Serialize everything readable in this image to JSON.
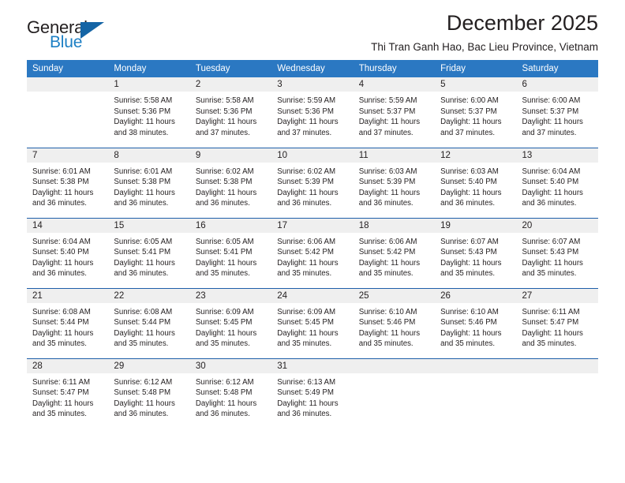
{
  "brand": {
    "name_part1": "General",
    "name_part2": "Blue",
    "logo_icon": "blue-triangle-icon",
    "color_primary": "#1464a5",
    "color_secondary": "#1c7fc4"
  },
  "header": {
    "title": "December 2025",
    "subtitle": "Thi Tran Ganh Hao, Bac Lieu Province, Vietnam"
  },
  "calendar": {
    "header_bg": "#2b78c2",
    "header_text_color": "#ffffff",
    "row_divider_color": "#1f5fa9",
    "daynum_band_color": "#efefef",
    "weekday_headers": [
      "Sunday",
      "Monday",
      "Tuesday",
      "Wednesday",
      "Thursday",
      "Friday",
      "Saturday"
    ],
    "labels": {
      "sunrise_prefix": "Sunrise:",
      "sunset_prefix": "Sunset:",
      "daylight_prefix": "Daylight:"
    },
    "weeks": [
      [
        {
          "day": "",
          "sunrise": "",
          "sunset": "",
          "daylight_line1": "",
          "daylight_line2": ""
        },
        {
          "day": "1",
          "sunrise": "Sunrise: 5:58 AM",
          "sunset": "Sunset: 5:36 PM",
          "daylight_line1": "Daylight: 11 hours",
          "daylight_line2": "and 38 minutes."
        },
        {
          "day": "2",
          "sunrise": "Sunrise: 5:58 AM",
          "sunset": "Sunset: 5:36 PM",
          "daylight_line1": "Daylight: 11 hours",
          "daylight_line2": "and 37 minutes."
        },
        {
          "day": "3",
          "sunrise": "Sunrise: 5:59 AM",
          "sunset": "Sunset: 5:36 PM",
          "daylight_line1": "Daylight: 11 hours",
          "daylight_line2": "and 37 minutes."
        },
        {
          "day": "4",
          "sunrise": "Sunrise: 5:59 AM",
          "sunset": "Sunset: 5:37 PM",
          "daylight_line1": "Daylight: 11 hours",
          "daylight_line2": "and 37 minutes."
        },
        {
          "day": "5",
          "sunrise": "Sunrise: 6:00 AM",
          "sunset": "Sunset: 5:37 PM",
          "daylight_line1": "Daylight: 11 hours",
          "daylight_line2": "and 37 minutes."
        },
        {
          "day": "6",
          "sunrise": "Sunrise: 6:00 AM",
          "sunset": "Sunset: 5:37 PM",
          "daylight_line1": "Daylight: 11 hours",
          "daylight_line2": "and 37 minutes."
        }
      ],
      [
        {
          "day": "7",
          "sunrise": "Sunrise: 6:01 AM",
          "sunset": "Sunset: 5:38 PM",
          "daylight_line1": "Daylight: 11 hours",
          "daylight_line2": "and 36 minutes."
        },
        {
          "day": "8",
          "sunrise": "Sunrise: 6:01 AM",
          "sunset": "Sunset: 5:38 PM",
          "daylight_line1": "Daylight: 11 hours",
          "daylight_line2": "and 36 minutes."
        },
        {
          "day": "9",
          "sunrise": "Sunrise: 6:02 AM",
          "sunset": "Sunset: 5:38 PM",
          "daylight_line1": "Daylight: 11 hours",
          "daylight_line2": "and 36 minutes."
        },
        {
          "day": "10",
          "sunrise": "Sunrise: 6:02 AM",
          "sunset": "Sunset: 5:39 PM",
          "daylight_line1": "Daylight: 11 hours",
          "daylight_line2": "and 36 minutes."
        },
        {
          "day": "11",
          "sunrise": "Sunrise: 6:03 AM",
          "sunset": "Sunset: 5:39 PM",
          "daylight_line1": "Daylight: 11 hours",
          "daylight_line2": "and 36 minutes."
        },
        {
          "day": "12",
          "sunrise": "Sunrise: 6:03 AM",
          "sunset": "Sunset: 5:40 PM",
          "daylight_line1": "Daylight: 11 hours",
          "daylight_line2": "and 36 minutes."
        },
        {
          "day": "13",
          "sunrise": "Sunrise: 6:04 AM",
          "sunset": "Sunset: 5:40 PM",
          "daylight_line1": "Daylight: 11 hours",
          "daylight_line2": "and 36 minutes."
        }
      ],
      [
        {
          "day": "14",
          "sunrise": "Sunrise: 6:04 AM",
          "sunset": "Sunset: 5:40 PM",
          "daylight_line1": "Daylight: 11 hours",
          "daylight_line2": "and 36 minutes."
        },
        {
          "day": "15",
          "sunrise": "Sunrise: 6:05 AM",
          "sunset": "Sunset: 5:41 PM",
          "daylight_line1": "Daylight: 11 hours",
          "daylight_line2": "and 36 minutes."
        },
        {
          "day": "16",
          "sunrise": "Sunrise: 6:05 AM",
          "sunset": "Sunset: 5:41 PM",
          "daylight_line1": "Daylight: 11 hours",
          "daylight_line2": "and 35 minutes."
        },
        {
          "day": "17",
          "sunrise": "Sunrise: 6:06 AM",
          "sunset": "Sunset: 5:42 PM",
          "daylight_line1": "Daylight: 11 hours",
          "daylight_line2": "and 35 minutes."
        },
        {
          "day": "18",
          "sunrise": "Sunrise: 6:06 AM",
          "sunset": "Sunset: 5:42 PM",
          "daylight_line1": "Daylight: 11 hours",
          "daylight_line2": "and 35 minutes."
        },
        {
          "day": "19",
          "sunrise": "Sunrise: 6:07 AM",
          "sunset": "Sunset: 5:43 PM",
          "daylight_line1": "Daylight: 11 hours",
          "daylight_line2": "and 35 minutes."
        },
        {
          "day": "20",
          "sunrise": "Sunrise: 6:07 AM",
          "sunset": "Sunset: 5:43 PM",
          "daylight_line1": "Daylight: 11 hours",
          "daylight_line2": "and 35 minutes."
        }
      ],
      [
        {
          "day": "21",
          "sunrise": "Sunrise: 6:08 AM",
          "sunset": "Sunset: 5:44 PM",
          "daylight_line1": "Daylight: 11 hours",
          "daylight_line2": "and 35 minutes."
        },
        {
          "day": "22",
          "sunrise": "Sunrise: 6:08 AM",
          "sunset": "Sunset: 5:44 PM",
          "daylight_line1": "Daylight: 11 hours",
          "daylight_line2": "and 35 minutes."
        },
        {
          "day": "23",
          "sunrise": "Sunrise: 6:09 AM",
          "sunset": "Sunset: 5:45 PM",
          "daylight_line1": "Daylight: 11 hours",
          "daylight_line2": "and 35 minutes."
        },
        {
          "day": "24",
          "sunrise": "Sunrise: 6:09 AM",
          "sunset": "Sunset: 5:45 PM",
          "daylight_line1": "Daylight: 11 hours",
          "daylight_line2": "and 35 minutes."
        },
        {
          "day": "25",
          "sunrise": "Sunrise: 6:10 AM",
          "sunset": "Sunset: 5:46 PM",
          "daylight_line1": "Daylight: 11 hours",
          "daylight_line2": "and 35 minutes."
        },
        {
          "day": "26",
          "sunrise": "Sunrise: 6:10 AM",
          "sunset": "Sunset: 5:46 PM",
          "daylight_line1": "Daylight: 11 hours",
          "daylight_line2": "and 35 minutes."
        },
        {
          "day": "27",
          "sunrise": "Sunrise: 6:11 AM",
          "sunset": "Sunset: 5:47 PM",
          "daylight_line1": "Daylight: 11 hours",
          "daylight_line2": "and 35 minutes."
        }
      ],
      [
        {
          "day": "28",
          "sunrise": "Sunrise: 6:11 AM",
          "sunset": "Sunset: 5:47 PM",
          "daylight_line1": "Daylight: 11 hours",
          "daylight_line2": "and 35 minutes."
        },
        {
          "day": "29",
          "sunrise": "Sunrise: 6:12 AM",
          "sunset": "Sunset: 5:48 PM",
          "daylight_line1": "Daylight: 11 hours",
          "daylight_line2": "and 36 minutes."
        },
        {
          "day": "30",
          "sunrise": "Sunrise: 6:12 AM",
          "sunset": "Sunset: 5:48 PM",
          "daylight_line1": "Daylight: 11 hours",
          "daylight_line2": "and 36 minutes."
        },
        {
          "day": "31",
          "sunrise": "Sunrise: 6:13 AM",
          "sunset": "Sunset: 5:49 PM",
          "daylight_line1": "Daylight: 11 hours",
          "daylight_line2": "and 36 minutes."
        },
        {
          "day": "",
          "sunrise": "",
          "sunset": "",
          "daylight_line1": "",
          "daylight_line2": ""
        },
        {
          "day": "",
          "sunrise": "",
          "sunset": "",
          "daylight_line1": "",
          "daylight_line2": ""
        },
        {
          "day": "",
          "sunrise": "",
          "sunset": "",
          "daylight_line1": "",
          "daylight_line2": ""
        }
      ]
    ]
  }
}
